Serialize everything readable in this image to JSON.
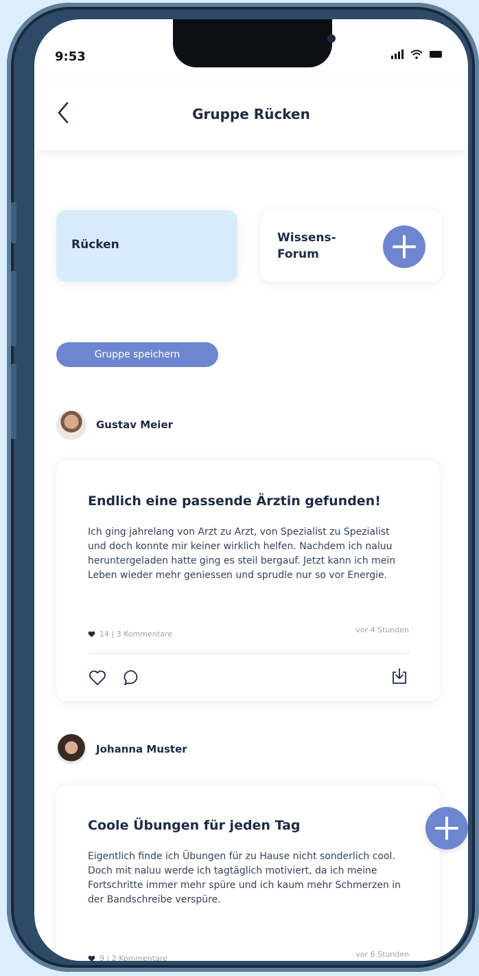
{
  "status_bar": {
    "time": "9:53"
  },
  "header": {
    "title": "Gruppe Rücken"
  },
  "categories": [
    {
      "label": "Rücken"
    },
    {
      "label_line1": "Wissens-",
      "label_line2": "Forum"
    }
  ],
  "save_group_label": "Gruppe speichern",
  "posts": [
    {
      "author": "Gustav Meier",
      "title": "Endlich eine passende Ärztin gefunden!",
      "body": "Ich ging jahrelang von Arzt zu Arzt, von Spezialist zu Spezialist und doch konnte mir keiner wirklich helfen. Nachdem ich naluu heruntergeladen hatte ging es steil bergauf. Jetzt kann ich mein Leben wieder mehr geniessen und sprudle nur so vor Energie.",
      "stats": "14 | 3 Kommentare",
      "time_ago": "vor 4 Stunden"
    },
    {
      "author": "Johanna Muster",
      "title": "Coole Übungen für jeden Tag",
      "body": "Eigentlich finde ich Übungen für zu Hause nicht sonderlich cool. Doch mit naluu werde ich tagtäglich motiviert, da ich meine Fortschritte immer mehr spüre und ich kaum mehr Schmerzen in der Bandschreibe verspüre.",
      "stats": "9 | 2 Kommentare",
      "time_ago": "vor 6 Stunden"
    }
  ],
  "colors": {
    "accent": "#6e86cf",
    "category_bg": "#d6ecfb",
    "frame": "#2d4a66"
  },
  "icons": [
    "back-arrow-icon",
    "plus-icon",
    "heart-icon",
    "comment-icon",
    "download-icon",
    "signal-icon",
    "wifi-icon",
    "battery-icon"
  ]
}
